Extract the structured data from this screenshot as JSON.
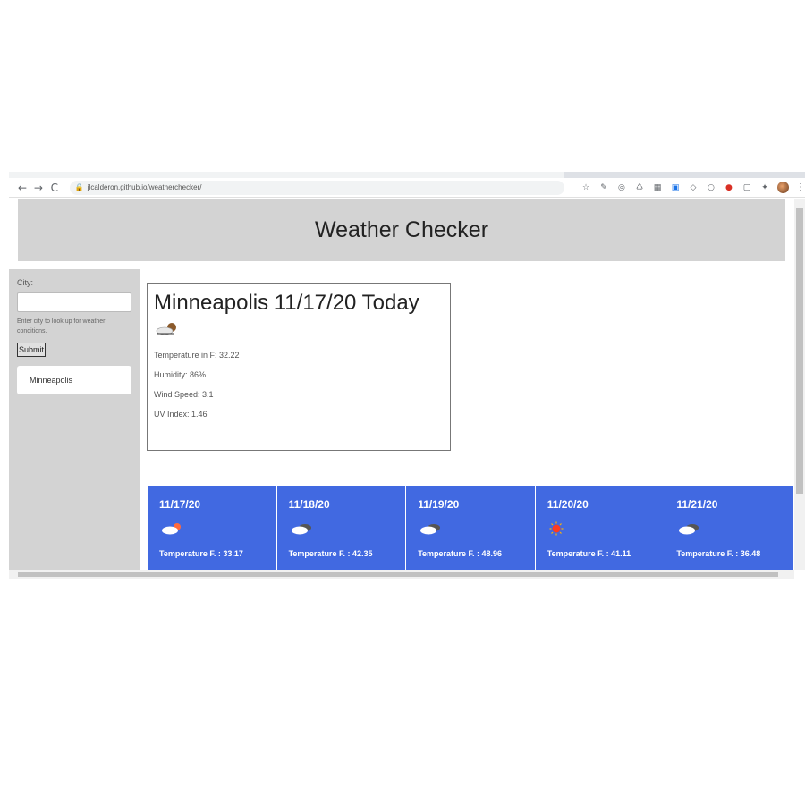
{
  "browser": {
    "url": "jlcalderon.github.io/weatherchecker/",
    "nav_back": "←",
    "nav_forward": "→",
    "nav_reload": "C",
    "lock_icon": "lock-icon",
    "extensions": [
      "star-icon",
      "eyedropper-icon",
      "extension-icon",
      "recycle-icon",
      "grid-icon",
      "css-icon",
      "shield-icon",
      "circle-icon",
      "notification-icon",
      "doc-icon",
      "puzzle-icon"
    ]
  },
  "page": {
    "title": "Weather Checker"
  },
  "sidebar": {
    "city_label": "City:",
    "city_input_value": "",
    "hint": "Enter city to look up for weather conditions.",
    "submit_label": "Submit",
    "history": [
      "Minneapolis"
    ]
  },
  "today": {
    "title": "Minneapolis 11/17/20 Today",
    "icon": "cloudy-night-icon",
    "temperature": "Temperature in F: 32.22",
    "humidity": "Humidity: 86%",
    "wind": "Wind Speed: 3.1",
    "uv": "UV Index: 1.46"
  },
  "forecast": [
    {
      "date": "11/17/20",
      "icon": "partly-sunny-icon",
      "temp": "Temperature F. : 33.17"
    },
    {
      "date": "11/18/20",
      "icon": "cloudy-icon",
      "temp": "Temperature F. : 42.35"
    },
    {
      "date": "11/19/20",
      "icon": "cloudy-icon",
      "temp": "Temperature F. : 48.96"
    },
    {
      "date": "11/20/20",
      "icon": "sun-icon",
      "temp": "Temperature F. : 41.11"
    },
    {
      "date": "11/21/20",
      "icon": "cloudy-icon",
      "temp": "Temperature F. : 36.48"
    }
  ],
  "colors": {
    "header_bg": "#d3d3d3",
    "forecast_bg": "#4169e1"
  }
}
